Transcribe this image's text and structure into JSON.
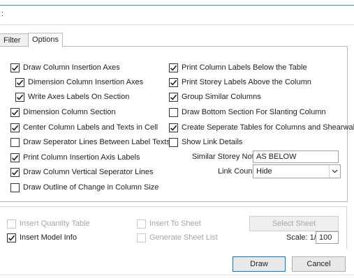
{
  "window": {
    "title_fragment": ":"
  },
  "tabs": [
    {
      "label": "Filter",
      "selected": false
    },
    {
      "label": "Options",
      "selected": true
    }
  ],
  "left_options": [
    {
      "label": "Draw Column Insertion Axes",
      "checked": true
    },
    {
      "label": "Dimension Column Insertion Axes",
      "checked": true
    },
    {
      "label": "Write Axes Labels On Section",
      "checked": true
    },
    {
      "label": "Dimension Column Section",
      "checked": true
    },
    {
      "label": "Center Column Labels and Texts in Cell",
      "checked": true
    },
    {
      "label": "Draw Seperator Lines Between Label Texts",
      "checked": false
    },
    {
      "label": "Print Column Insertion Axis Labels",
      "checked": true
    },
    {
      "label": "Draw Column Vertical Seperator Lines",
      "checked": true
    },
    {
      "label": "Draw Outline of Change in Column Size",
      "checked": false
    }
  ],
  "right_options": [
    {
      "label": "Print Column Labels Below the Table",
      "checked": true
    },
    {
      "label": "Print Storey Labels Above the Column",
      "checked": true
    },
    {
      "label": "Group Similar Columns",
      "checked": true
    },
    {
      "label": "Draw Bottom Section For Slanting Column",
      "checked": false
    },
    {
      "label": "Create Seperate Tables for Columns and Shearwalls",
      "checked": true
    },
    {
      "label": "Show Link Details",
      "checked": false
    }
  ],
  "similar_storey_note": {
    "label": "Similar Storey Note:",
    "value": "AS BELOW"
  },
  "link_count": {
    "label": "Link Count:",
    "value": "Hide"
  },
  "sheet": {
    "insert_quantity_table": {
      "label": "Insert Quantity Table",
      "checked": false,
      "enabled": false
    },
    "insert_to_sheet": {
      "label": "Insert To Sheet",
      "checked": false,
      "enabled": false
    },
    "select_sheet_label": "Select Sheet",
    "insert_model_info": {
      "label": "Insert Model Info",
      "checked": true,
      "enabled": true
    },
    "generate_sheet_list": {
      "label": "Generate Sheet List",
      "checked": false,
      "enabled": false
    },
    "scale_label": "Scale: 1/",
    "scale_value": "100"
  },
  "buttons": {
    "draw": "Draw",
    "cancel": "Cancel"
  }
}
